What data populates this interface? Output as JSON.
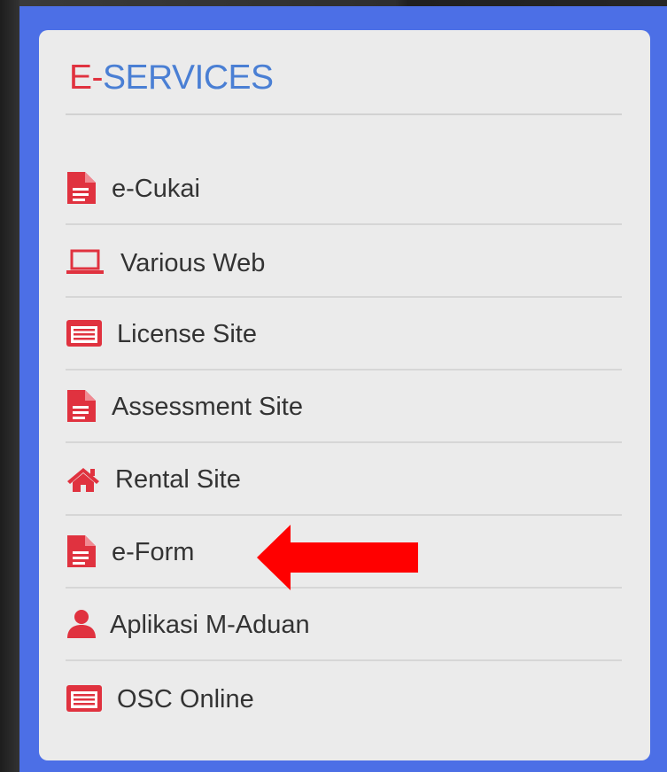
{
  "panel": {
    "title_prefix": "E-",
    "title_rest": "SERVICES"
  },
  "menu": {
    "items": [
      {
        "label": "e-Cukai",
        "icon": "file-text-icon"
      },
      {
        "label": "Various Web",
        "icon": "laptop-icon"
      },
      {
        "label": "License Site",
        "icon": "list-alt-icon"
      },
      {
        "label": "Assessment Site",
        "icon": "file-text-icon"
      },
      {
        "label": "Rental Site",
        "icon": "home-icon"
      },
      {
        "label": "e-Form",
        "icon": "file-text-icon"
      },
      {
        "label": "Aplikasi M-Aduan",
        "icon": "user-icon"
      },
      {
        "label": "OSC Online",
        "icon": "list-alt-icon"
      }
    ]
  },
  "annotation": {
    "icon": "left-arrow-icon",
    "color": "#ff0000"
  },
  "colors": {
    "frame_blue": "#4c6fe6",
    "title_red": "#e0323f",
    "title_blue": "#4a7fd4",
    "icon_red": "#e0323f",
    "panel_bg": "#ebebeb"
  }
}
